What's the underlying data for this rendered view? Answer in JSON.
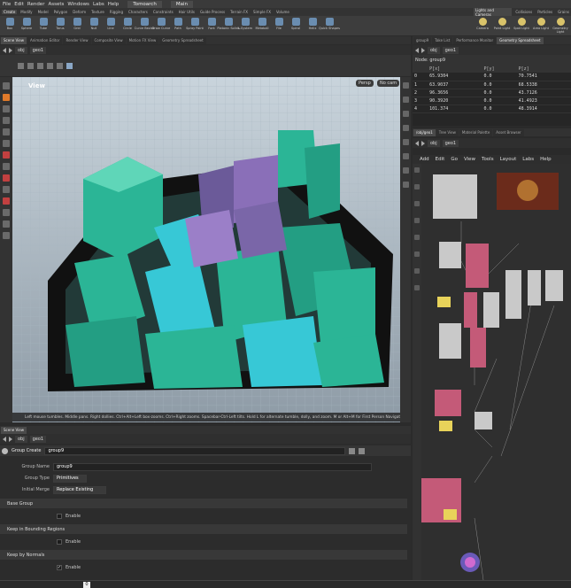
{
  "menubar": {
    "items": [
      "File",
      "Edit",
      "Render",
      "Assets",
      "Windows",
      "Labs",
      "Help"
    ],
    "desktop_label": "Tomoarch",
    "build_label": "Main"
  },
  "shelf_tabs": {
    "left": [
      "Create",
      "Modify",
      "Model",
      "Polygon",
      "Deform",
      "Texture",
      "Rigging",
      "Characters",
      "Constraints",
      "Hair Utils",
      "Guide Process",
      "Terrain FX",
      "Simple FX",
      "Volume"
    ],
    "active_left": 0,
    "right": [
      "Lights and Cameras",
      "Collisions",
      "Particles",
      "Grains"
    ],
    "active_right": 0
  },
  "shelf_tools": [
    "Box",
    "Sphere",
    "Tube",
    "Torus",
    "Grid",
    "Null",
    "Line",
    "Circle",
    "Curve Bezier",
    "Draw Curve",
    "Path",
    "Spray Paint",
    "Font",
    "Platonic Solids",
    "L-System",
    "Metaball",
    "File",
    "Spiral",
    "Helix",
    "Quick Shapes"
  ],
  "shelf_tools_right": [
    "Camera",
    "Point Light",
    "Spot Light",
    "Area Light",
    "Geometry Light"
  ],
  "viewer": {
    "tabs": [
      "Scene View",
      "Animation Editor",
      "Render View",
      "Composite View",
      "Motion FX View",
      "Geometry Spreadsheet"
    ],
    "active_tab": 0,
    "path_obj": "obj",
    "path_geo": "geo1",
    "title": "View",
    "persp_label": "Persp",
    "cam_label": "No cam",
    "hint": "Left mouse tumbles. Middle pans. Right dollies. Ctrl+Alt+Left box-zooms. Ctrl+Right zooms. Spacebar-Ctrl-Left tilts. Hold L for alternate tumble, dolly, and zoom. M or Alt+M for First Person Navigation."
  },
  "params": {
    "tabs": [
      "Scene View"
    ],
    "path_obj": "obj",
    "path_geo": "geo1",
    "node_type": "Group Create",
    "node_name": "group9",
    "group_name_label": "Group Name",
    "group_name_value": "group9",
    "group_type_label": "Group Type",
    "group_type_value": "Primitives",
    "initial_merge_label": "Initial Merge",
    "initial_merge_value": "Replace Existing",
    "sections": [
      "Base Group",
      "Keep in Bounding Regions",
      "Keep by Normals"
    ],
    "enable_label": "Enable",
    "enable_states": [
      false,
      false,
      true
    ],
    "frame_value": "0"
  },
  "spreadsheet": {
    "tabs": [
      "group9",
      "Take List",
      "Performance Monitor",
      "Geometry Spreadsheet"
    ],
    "active_tab": 3,
    "path_obj": "obj",
    "path_geo": "geo1",
    "node_label": "Node: group9",
    "columns": [
      "",
      "P[x]",
      "P[y]",
      "P[z]"
    ],
    "rows": [
      [
        "0",
        "65.9304",
        "0.0",
        "70.7541"
      ],
      [
        "1",
        "63.9037",
        "0.0",
        "68.5338"
      ],
      [
        "2",
        "96.3656",
        "0.0",
        "43.7126"
      ],
      [
        "3",
        "90.3920",
        "0.0",
        "41.4923"
      ],
      [
        "4",
        "101.374",
        "0.0",
        "48.3914"
      ]
    ]
  },
  "network": {
    "tabs": [
      "/obj/geo1",
      "Tree View",
      "Material Palette",
      "Asset Browser"
    ],
    "active_tab": 0,
    "path_obj": "obj",
    "path_geo": "geo1",
    "menu": [
      "Add",
      "Edit",
      "Go",
      "View",
      "Tools",
      "Layout",
      "Labs",
      "Help"
    ]
  },
  "colors": {
    "accent": "#e07a2a",
    "building_teal": "#2bb596",
    "building_cyan": "#37c8d6",
    "node_pink": "#c45a78",
    "node_yellow": "#e8d35a",
    "node_gray": "#b6b6b6"
  }
}
